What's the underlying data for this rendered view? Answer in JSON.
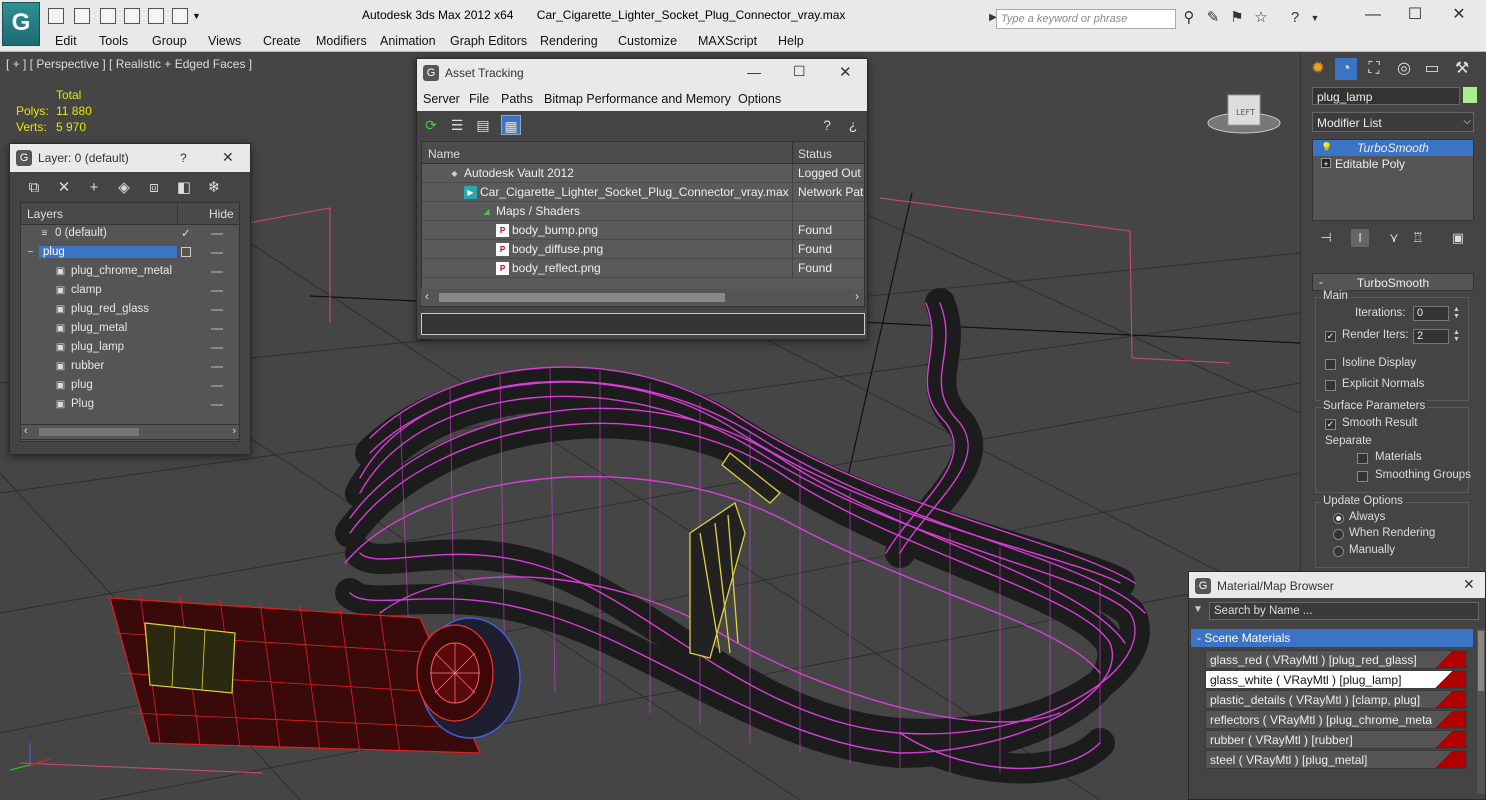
{
  "titlebar": {
    "app": "Autodesk 3ds Max  2012 x64",
    "file": "Car_Cigarette_Lighter_Socket_Plug_Connector_vray.max",
    "search_placeholder": "Type a keyword or phrase"
  },
  "menu": [
    "Edit",
    "Tools",
    "Group",
    "Views",
    "Create",
    "Modifiers",
    "Animation",
    "Graph Editors",
    "Rendering",
    "Customize",
    "MAXScript",
    "Help"
  ],
  "viewport": {
    "label": "[ + ] [ Perspective ] [ Realistic + Edged Faces ]",
    "stats_header": "Total",
    "polys_label": "Polys:",
    "polys_value": "11 880",
    "verts_label": "Verts:",
    "verts_value": "5 970"
  },
  "layer_panel": {
    "title": "Layer: 0 (default)",
    "help": "?",
    "col_layers": "Layers",
    "col_hide": "Hide",
    "rows": [
      {
        "name": "0 (default)",
        "level": 0,
        "checked": true
      },
      {
        "name": "plug",
        "level": 0,
        "selected": true
      },
      {
        "name": "plug_chrome_metal",
        "level": 1
      },
      {
        "name": "clamp",
        "level": 1
      },
      {
        "name": "plug_red_glass",
        "level": 1
      },
      {
        "name": "plug_metal",
        "level": 1
      },
      {
        "name": "plug_lamp",
        "level": 1
      },
      {
        "name": "rubber",
        "level": 1
      },
      {
        "name": "plug",
        "level": 1
      },
      {
        "name": "Plug",
        "level": 1
      }
    ]
  },
  "asset_panel": {
    "title": "Asset Tracking",
    "menu": [
      "Server",
      "File",
      "Paths",
      "Bitmap Performance and Memory",
      "Options"
    ],
    "col_name": "Name",
    "col_status": "Status",
    "rows": [
      {
        "name": "Autodesk Vault 2012",
        "status": "Logged Out",
        "indent": 1,
        "icon": "vault"
      },
      {
        "name": "Car_Cigarette_Lighter_Socket_Plug_Connector_vray.max",
        "status": "Network Pat",
        "indent": 2,
        "icon": "max"
      },
      {
        "name": "Maps / Shaders",
        "status": "",
        "indent": 3,
        "icon": "maps"
      },
      {
        "name": "body_bump.png",
        "status": "Found",
        "indent": 4,
        "icon": "png"
      },
      {
        "name": "body_diffuse.png",
        "status": "Found",
        "indent": 4,
        "icon": "png"
      },
      {
        "name": "body_reflect.png",
        "status": "Found",
        "indent": 4,
        "icon": "png"
      }
    ]
  },
  "command_panel": {
    "object_name": "plug_lamp",
    "object_color": "#a6f090",
    "modifier_list": "Modifier List",
    "stack": [
      {
        "name": "TurboSmooth",
        "selected": true
      },
      {
        "name": "Editable Poly",
        "selected": false
      }
    ],
    "rollout_title": "TurboSmooth",
    "main_label": "Main",
    "iterations_label": "Iterations:",
    "iterations_value": "0",
    "render_iters_label": "Render Iters:",
    "render_iters_value": "2",
    "isoline_label": "Isoline Display",
    "explicit_label": "Explicit Normals",
    "surface_label": "Surface Parameters",
    "smooth_label": "Smooth Result",
    "separate_label": "Separate",
    "materials_label": "Materials",
    "smoothing_groups_label": "Smoothing Groups",
    "update_label": "Update Options",
    "always_label": "Always",
    "when_rendering_label": "When Rendering",
    "manually_label": "Manually"
  },
  "material_browser": {
    "title": "Material/Map Browser",
    "search": "Search by Name ...",
    "section": "- Scene Materials",
    "materials": [
      "glass_red  ( VRayMtl ) [plug_red_glass]",
      "glass_white  ( VRayMtl ) [plug_lamp]",
      "plastic_details  ( VRayMtl ) [clamp, plug]",
      "reflectors  ( VRayMtl ) [plug_chrome_metal]",
      "rubber  ( VRayMtl ) [rubber]",
      "steel  ( VRayMtl ) [plug_metal]"
    ],
    "selected_index": 1
  },
  "colors": {
    "cable_wire": "#e040e0",
    "plug_wire": "#e02020",
    "clamp_wire": "#e0d040",
    "tip_wire": "#4060e0",
    "selection": "#3b73c5"
  }
}
